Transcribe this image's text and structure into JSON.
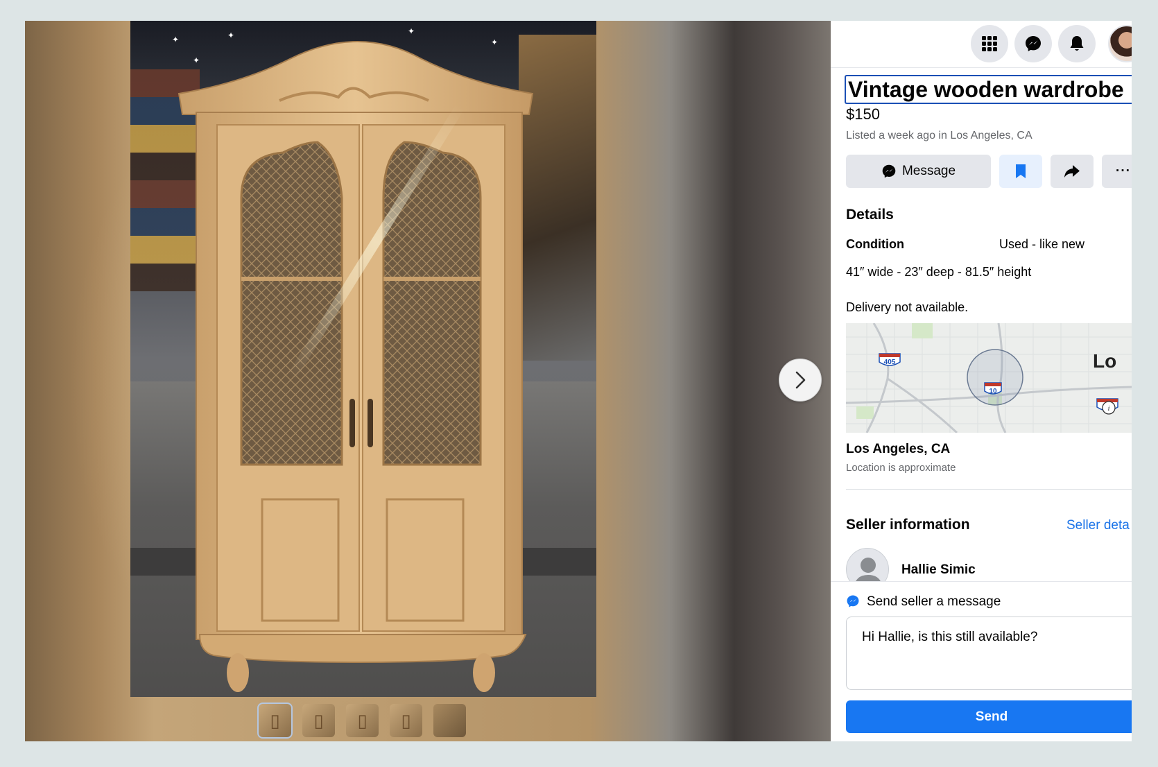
{
  "listing": {
    "title": "Vintage wooden wardrobe",
    "price": "$150",
    "listed": "Listed a week ago in Los Angeles, CA"
  },
  "actions": {
    "message_label": "Message",
    "save_icon": "bookmark-icon",
    "share_icon": "share-icon",
    "more_label": "···"
  },
  "details": {
    "heading": "Details",
    "condition_label": "Condition",
    "condition_value": "Used - like new",
    "dimensions": "41″ wide - 23″ deep - 81.5″ height",
    "delivery": "Delivery not available."
  },
  "map": {
    "highway_405": "405",
    "highway_10": "10",
    "city_fragment": "Lo"
  },
  "location": {
    "city": "Los Angeles, CA",
    "note": "Location is approximate"
  },
  "seller": {
    "heading": "Seller information",
    "details_link": "Seller deta",
    "name": "Hallie Simic"
  },
  "composer": {
    "label": "Send seller a message",
    "message": "Hi Hallie, is this still available?",
    "send_label": "Send"
  },
  "topbar": {
    "icons": [
      "apps-grid-icon",
      "messenger-icon",
      "bell-icon",
      "profile-avatar"
    ]
  },
  "gallery": {
    "thumbnail_count": 5,
    "active_index": 0
  },
  "colors": {
    "accent": "#1877f2",
    "link": "#1a73e8",
    "button_gray": "#e4e6eb",
    "save_bg": "#e7f0fd"
  }
}
